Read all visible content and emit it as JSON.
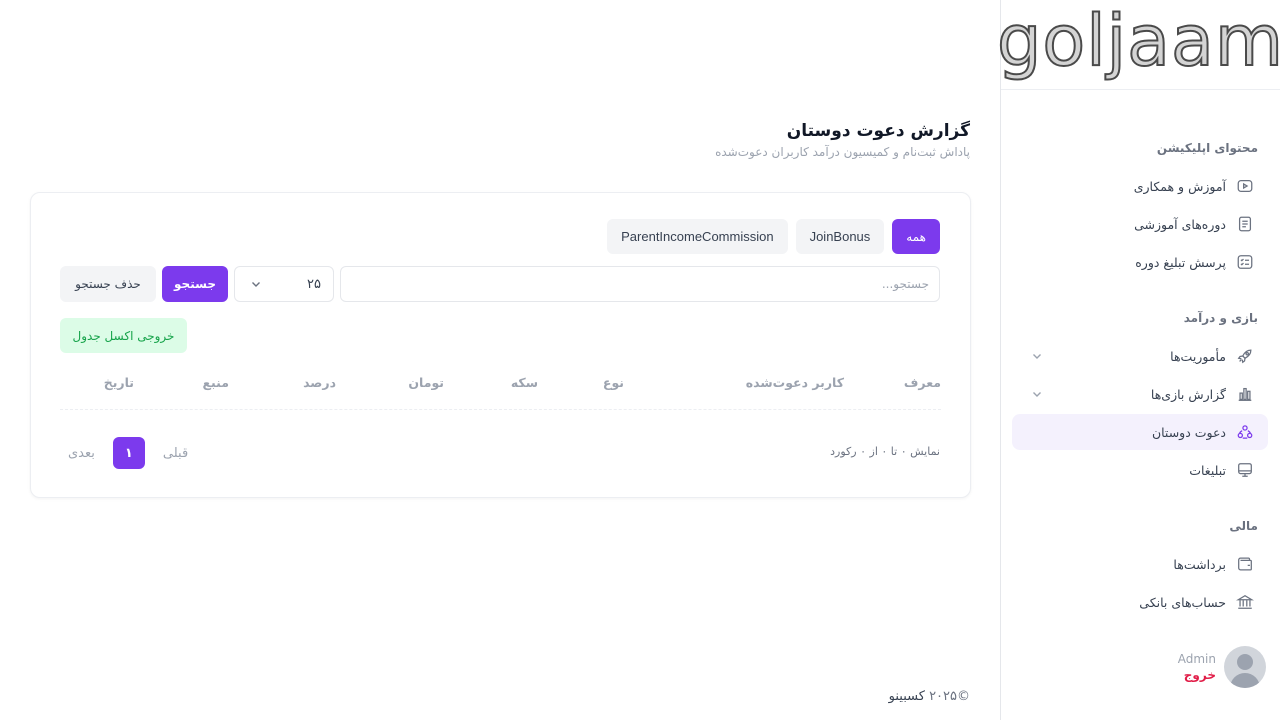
{
  "brand": {
    "logo_text": "goljaam"
  },
  "sidebar": {
    "sections": [
      {
        "title": "محتوای اپلیکیشن",
        "items": [
          {
            "label": "آموزش و همکاری",
            "icon": "video-icon"
          },
          {
            "label": "دوره‌های آموزشی",
            "icon": "document-icon"
          },
          {
            "label": "پرسش تبلیغ دوره",
            "icon": "checklist-icon"
          }
        ]
      },
      {
        "title": "بازی و درآمد",
        "items": [
          {
            "label": "مأموریت‌ها",
            "icon": "rocket-icon"
          },
          {
            "label": "گزارش بازی‌ها",
            "icon": "bar-chart-icon"
          },
          {
            "label": "دعوت دوستان",
            "icon": "users-circle-icon"
          },
          {
            "label": "تبلیغات",
            "icon": "monitor-icon"
          }
        ]
      },
      {
        "title": "مالی",
        "items": [
          {
            "label": "برداشت‌ها",
            "icon": "wallet-icon"
          },
          {
            "label": "حساب‌های بانکی",
            "icon": "bank-icon"
          }
        ]
      }
    ],
    "user": {
      "name": "Admin",
      "logout": "خروج"
    }
  },
  "page": {
    "title": "گزارش دعوت دوستان",
    "subtitle": "پاداش ثبت‌نام و کمیسیون درآمد کاربران دعوت‌شده"
  },
  "filters": {
    "all": "همه",
    "join_bonus": "JoinBonus",
    "parent_income": "ParentIncomeCommission"
  },
  "search": {
    "placeholder": "جستجو...",
    "per_page": "۲۵",
    "search_label": "جستجو",
    "clear_label": "حذف جستجو",
    "excel_label": "خروجی اکسل جدول"
  },
  "table": {
    "columns": [
      "معرف",
      "کاربر دعوت‌شده",
      "نوع",
      "سکه",
      "تومان",
      "درصد",
      "منبع",
      "تاریخ"
    ]
  },
  "pagination": {
    "records_text": "نمایش ۰ تا ۰ از ۰ رکورد",
    "prev": "قبلی",
    "current": "۱",
    "next": "بعدی"
  },
  "footer": {
    "year": "©۲۰۲۵",
    "brand": "کسبینو"
  },
  "colors": {
    "accent": "#7c3aed",
    "danger": "#e11d48",
    "success": "#16a34a"
  }
}
